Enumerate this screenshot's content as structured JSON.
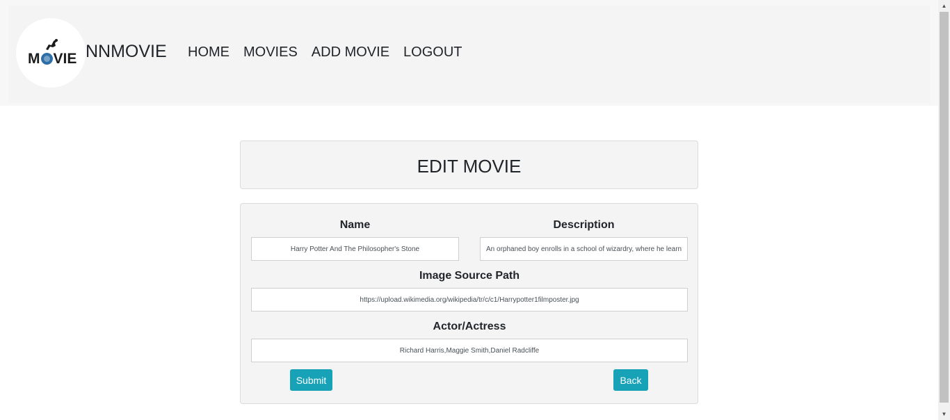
{
  "header": {
    "logo_text": "MOVIE",
    "logo_text_pre": "M",
    "logo_text_post": "VIE",
    "brand": "NNMOVIE",
    "nav": [
      {
        "label": "HOME"
      },
      {
        "label": "MOVIES"
      },
      {
        "label": "ADD MOVIE"
      },
      {
        "label": "LOGOUT"
      }
    ]
  },
  "page": {
    "title": "EDIT MOVIE"
  },
  "form": {
    "name_label": "Name",
    "name_value": "Harry Potter And The Philosopher's Stone",
    "description_label": "Description",
    "description_value": "An orphaned boy enrolls in a school of wizardry, where he learns",
    "image_label": "Image Source Path",
    "image_value": "https://upload.wikimedia.org/wikipedia/tr/c/c1/Harrypotter1filmposter.jpg",
    "actor_label": "Actor/Actress",
    "actor_value": "Richard Harris,Maggie Smith,Daniel Radcliffe",
    "submit_label": "Submit",
    "back_label": "Back"
  },
  "colors": {
    "accent": "#17a2b8",
    "header_bg": "#f4f4f4",
    "card_bg": "#f4f4f4"
  }
}
